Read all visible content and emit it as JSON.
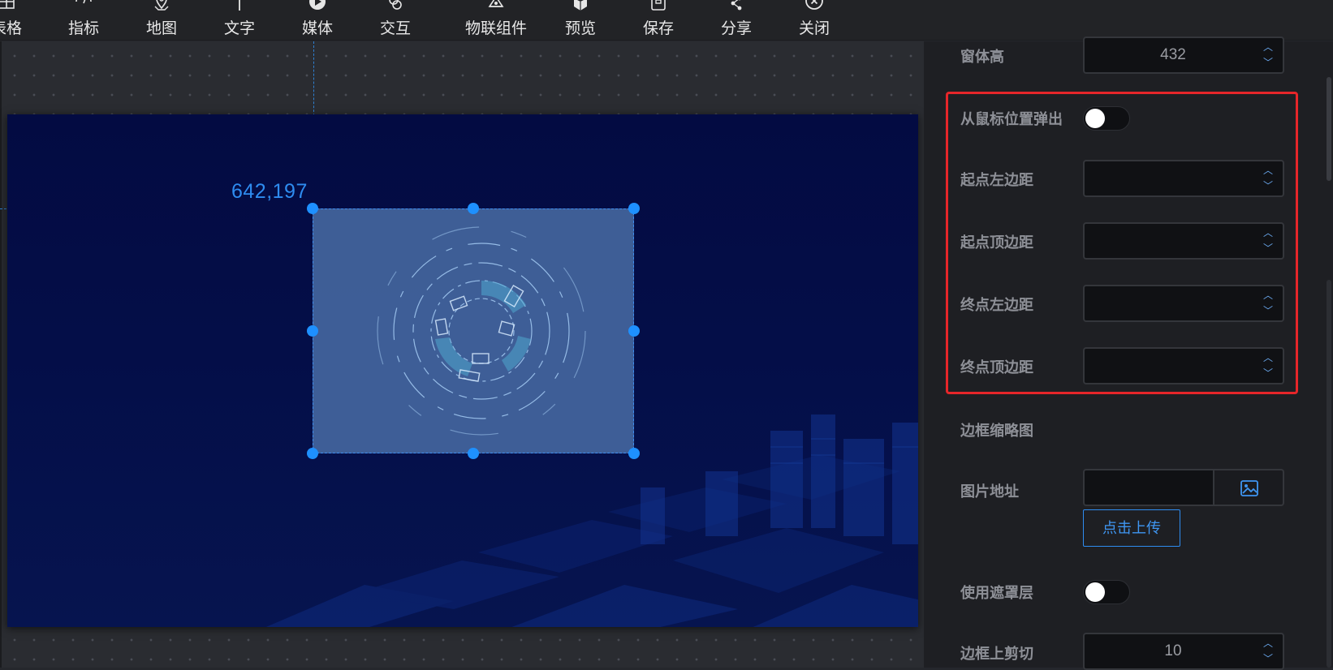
{
  "toolbar": {
    "items": [
      {
        "label": "表格",
        "icon": "table-icon"
      },
      {
        "label": "指标",
        "icon": "gauge-icon"
      },
      {
        "label": "地图",
        "icon": "map-pin-icon"
      },
      {
        "label": "文字",
        "icon": "text-icon"
      },
      {
        "label": "媒体",
        "icon": "play-icon"
      },
      {
        "label": "交互",
        "icon": "interact-icon"
      },
      {
        "label": "物联组件",
        "icon": "iot-icon"
      },
      {
        "label": "预览",
        "icon": "cube-icon"
      },
      {
        "label": "保存",
        "icon": "save-icon"
      },
      {
        "label": "分享",
        "icon": "share-icon"
      },
      {
        "label": "关闭",
        "icon": "close-icon"
      }
    ]
  },
  "canvas": {
    "coordinate_readout": "642,197"
  },
  "panel": {
    "window_height": {
      "label": "窗体高",
      "value": "432"
    },
    "popup_from_mouse": {
      "label": "从鼠标位置弹出",
      "enabled": false
    },
    "start_left": {
      "label": "起点左边距",
      "value": ""
    },
    "start_top": {
      "label": "起点顶边距",
      "value": ""
    },
    "end_left": {
      "label": "终点左边距",
      "value": ""
    },
    "end_top": {
      "label": "终点顶边距",
      "value": ""
    },
    "border_thumbnail": {
      "label": "边框缩略图"
    },
    "image_url": {
      "label": "图片地址",
      "value": "",
      "upload_label": "点击上传"
    },
    "use_mask": {
      "label": "使用遮罩层",
      "enabled": false
    },
    "border_top_clip": {
      "label": "边框上剪切",
      "value": "10"
    }
  },
  "colors": {
    "accent": "#1e90ff",
    "highlight": "#e6262a",
    "stage_bg": "#040e48"
  }
}
